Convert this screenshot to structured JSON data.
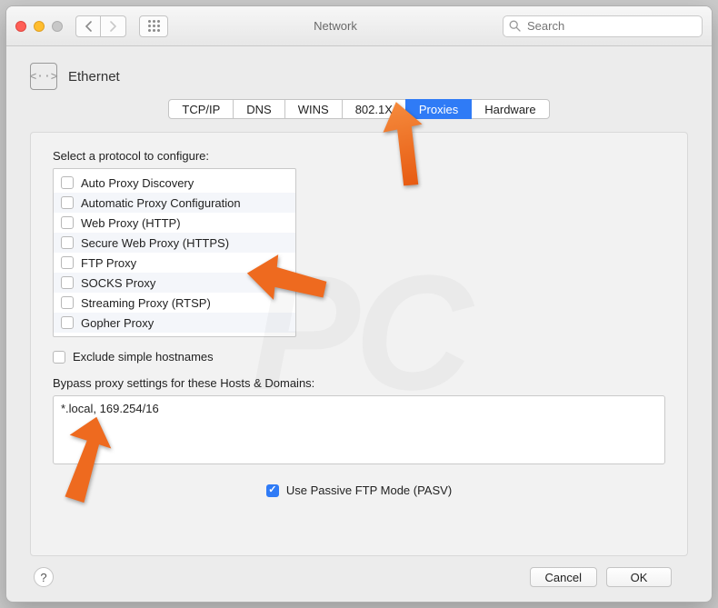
{
  "window": {
    "title": "Network"
  },
  "search": {
    "placeholder": "Search"
  },
  "header": {
    "interface": "Ethernet"
  },
  "tabs": [
    {
      "label": "TCP/IP",
      "active": false
    },
    {
      "label": "DNS",
      "active": false
    },
    {
      "label": "WINS",
      "active": false
    },
    {
      "label": "802.1X",
      "active": false
    },
    {
      "label": "Proxies",
      "active": true
    },
    {
      "label": "Hardware",
      "active": false
    }
  ],
  "protocols": {
    "label": "Select a protocol to configure:",
    "items": [
      {
        "label": "Auto Proxy Discovery",
        "checked": false
      },
      {
        "label": "Automatic Proxy Configuration",
        "checked": false
      },
      {
        "label": "Web Proxy (HTTP)",
        "checked": false
      },
      {
        "label": "Secure Web Proxy (HTTPS)",
        "checked": false
      },
      {
        "label": "FTP Proxy",
        "checked": false
      },
      {
        "label": "SOCKS Proxy",
        "checked": false
      },
      {
        "label": "Streaming Proxy (RTSP)",
        "checked": false
      },
      {
        "label": "Gopher Proxy",
        "checked": false
      }
    ]
  },
  "exclude": {
    "label": "Exclude simple hostnames",
    "checked": false
  },
  "bypass": {
    "label": "Bypass proxy settings for these Hosts & Domains:",
    "value": "*.local, 169.254/16"
  },
  "pasv": {
    "label": "Use Passive FTP Mode (PASV)",
    "checked": true
  },
  "buttons": {
    "help": "?",
    "cancel": "Cancel",
    "ok": "OK"
  },
  "colors": {
    "accent": "#2f7bf6",
    "arrow": "#ee6a1f"
  }
}
